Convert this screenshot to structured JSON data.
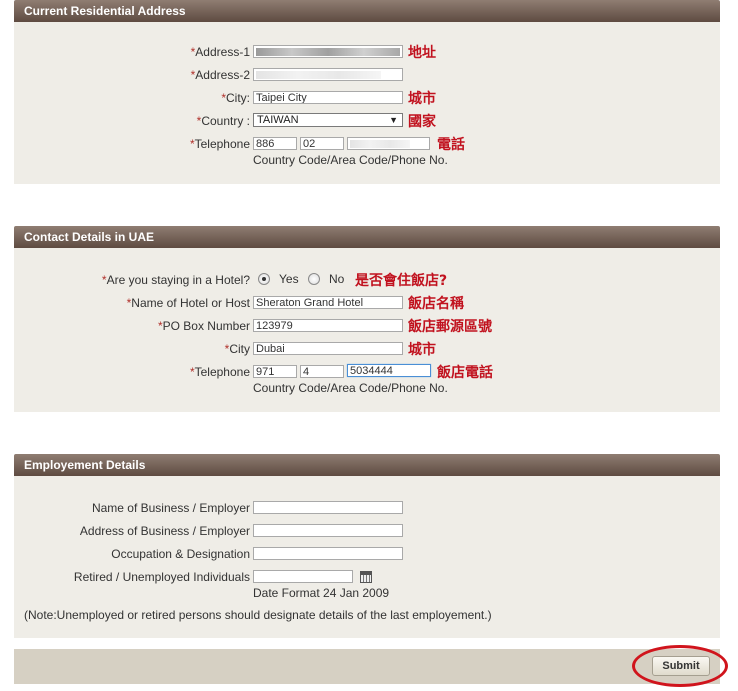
{
  "sections": {
    "residential": {
      "title": "Current Residential Address",
      "address1_label": "Address-1",
      "address2_label": "Address-2",
      "city_label": "City:",
      "city_value": "Taipei City",
      "country_label": "Country :",
      "country_value": "TAIWAN",
      "telephone_label": "Telephone",
      "tel_country": "886",
      "tel_area": "02",
      "tel_hint": "Country Code/Area Code/Phone No.",
      "ann_address": "地址",
      "ann_city": "城市",
      "ann_country": "國家",
      "ann_phone": "電話"
    },
    "uae": {
      "title": "Contact Details in UAE",
      "hotel_question": "Are you staying in a Hotel?",
      "yes_label": "Yes",
      "no_label": "No",
      "hotel_name_label": "Name of Hotel or Host",
      "hotel_name_value": "Sheraton Grand Hotel",
      "pobox_label": "PO Box Number",
      "pobox_value": "123979",
      "city_label": "City",
      "city_value": "Dubai",
      "telephone_label": "Telephone",
      "tel_country": "971",
      "tel_area": "4",
      "tel_number": "5034444",
      "tel_hint": "Country Code/Area Code/Phone No.",
      "ann_hotel_q": "是否會住飯店?",
      "ann_hotel_name": "飯店名稱",
      "ann_pobox": "飯店郵源區號",
      "ann_city": "城市",
      "ann_phone": "飯店電話"
    },
    "employment": {
      "title": "Employement Details",
      "business_name_label": "Name of Business / Employer",
      "business_address_label": "Address of Business / Employer",
      "occupation_label": "Occupation & Designation",
      "retired_label": "Retired / Unemployed Individuals",
      "date_format": "Date Format 24 Jan 2009",
      "note": "(Note:Unemployed or retired persons should designate details of the last employement.)"
    }
  },
  "required_marker": "*",
  "submit_label": "Submit",
  "colors": {
    "header_gradient_top": "#8f7d72",
    "header_gradient_bottom": "#5e4b41",
    "panel_bg": "#efede7",
    "annotation_red": "#c1121f"
  }
}
